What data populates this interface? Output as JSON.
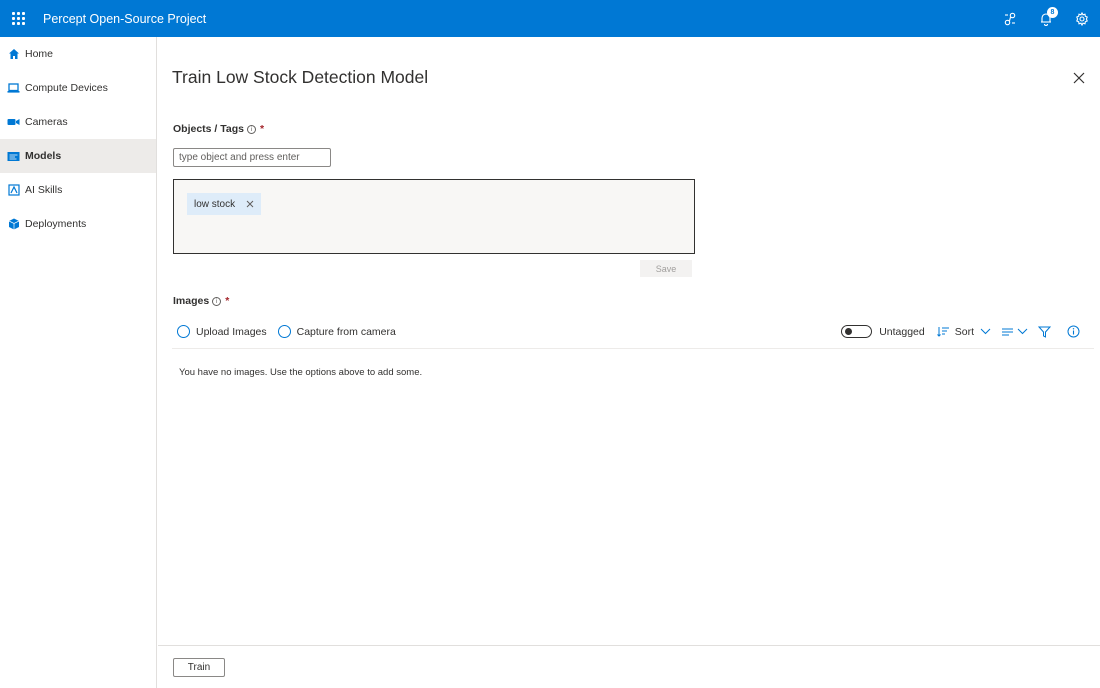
{
  "app": {
    "title": "Percept Open-Source Project",
    "notification_count": "8"
  },
  "sidebar": {
    "items": [
      {
        "label": "Home",
        "icon": "home-icon"
      },
      {
        "label": "Compute Devices",
        "icon": "laptop-icon"
      },
      {
        "label": "Cameras",
        "icon": "video-camera-icon"
      },
      {
        "label": "Models",
        "icon": "model-icon",
        "active": true
      },
      {
        "label": "AI Skills",
        "icon": "skills-icon"
      },
      {
        "label": "Deployments",
        "icon": "cube-icon"
      }
    ]
  },
  "panel": {
    "title": "Train Low Stock Detection Model",
    "objects_label": "Objects / Tags",
    "required_mark": "*",
    "tag_input_placeholder": "type object and press enter",
    "tags": [
      "low stock"
    ],
    "save_label": "Save",
    "images_label": "Images",
    "upload_label": "Upload Images",
    "capture_label": "Capture from camera",
    "untagged_label": "Untagged",
    "sort_label": "Sort",
    "empty_message": "You have no images. Use the options above to add some.",
    "train_label": "Train"
  },
  "colors": {
    "accent": "#0078d4",
    "chip_bg": "#deecf9",
    "required": "#a4262c"
  }
}
